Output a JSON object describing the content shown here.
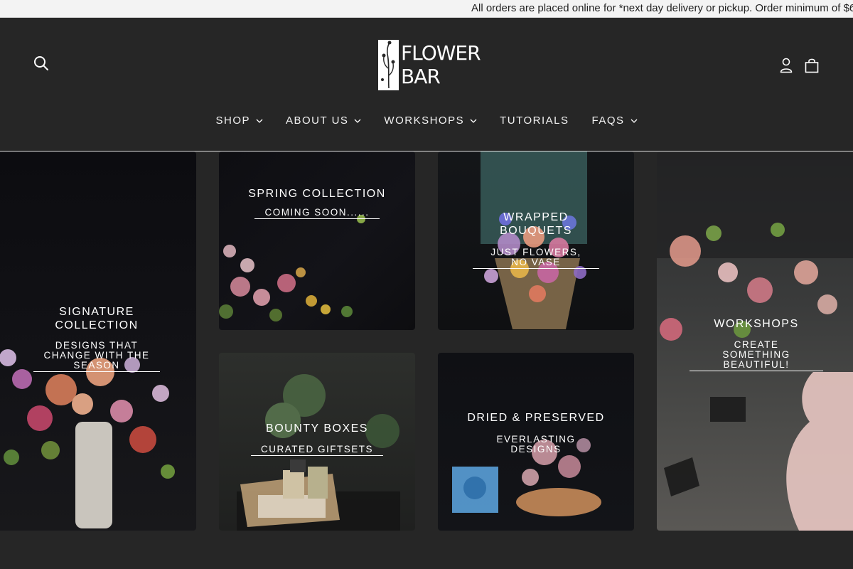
{
  "announcement": "All orders are placed online for *next day delivery or pickup. Order minimum of $6",
  "brand": {
    "line1": "FLOWER",
    "line2": "BAR"
  },
  "nav": [
    {
      "label": "SHOP",
      "has_dropdown": true
    },
    {
      "label": "ABOUT US",
      "has_dropdown": true
    },
    {
      "label": "WORKSHOPS",
      "has_dropdown": true
    },
    {
      "label": "TUTORIALS",
      "has_dropdown": false
    },
    {
      "label": "FAQS",
      "has_dropdown": true
    }
  ],
  "icons": {
    "search": "search-icon",
    "account": "user-icon",
    "cart": "shopping-bag-icon",
    "dropdown": "chevron-down-icon"
  },
  "tiles": {
    "signature": {
      "title": "SIGNATURE COLLECTION",
      "link": "DESIGNS THAT CHANGE WITH THE SEASON"
    },
    "spring": {
      "title": "SPRING COLLECTION",
      "link": "COMING SOON......"
    },
    "wrapped": {
      "title": "WRAPPED BOUQUETS",
      "link": "JUST FLOWERS, NO VASE"
    },
    "workshops": {
      "title": "WORKSHOPS",
      "link": "CREATE SOMETHING BEAUTIFUL!"
    },
    "bounty": {
      "title": "BOUNTY BOXES",
      "link": "CURATED GIFTSETS"
    },
    "dried": {
      "title": "DRIED & PRESERVED",
      "link": "EVERLASTING DESIGNS"
    }
  },
  "colors": {
    "background": "#262626",
    "announcement_bg": "#f3f3f3",
    "text_light": "#ffffff"
  }
}
